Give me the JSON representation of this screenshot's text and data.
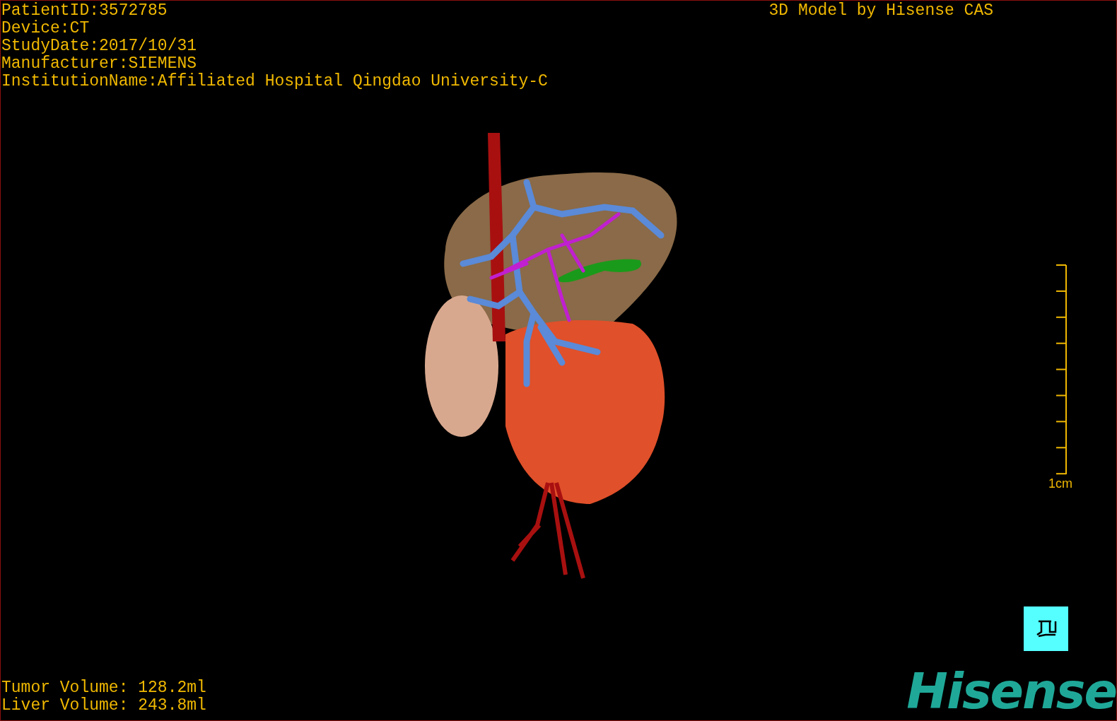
{
  "study_info": [
    "PatientID:3572785",
    "Device:CT",
    "StudyDate:2017/10/31",
    "Manufacturer:SIEMENS",
    "InstitutionName:Affiliated Hospital Qingdao University-C"
  ],
  "title": "3D Model by Hisense CAS",
  "scale_bar": {
    "label": "1cm"
  },
  "volumes": [
    "Tumor Volume: 128.2ml",
    "Liver Volume: 243.8ml"
  ],
  "logo": "Hisense"
}
